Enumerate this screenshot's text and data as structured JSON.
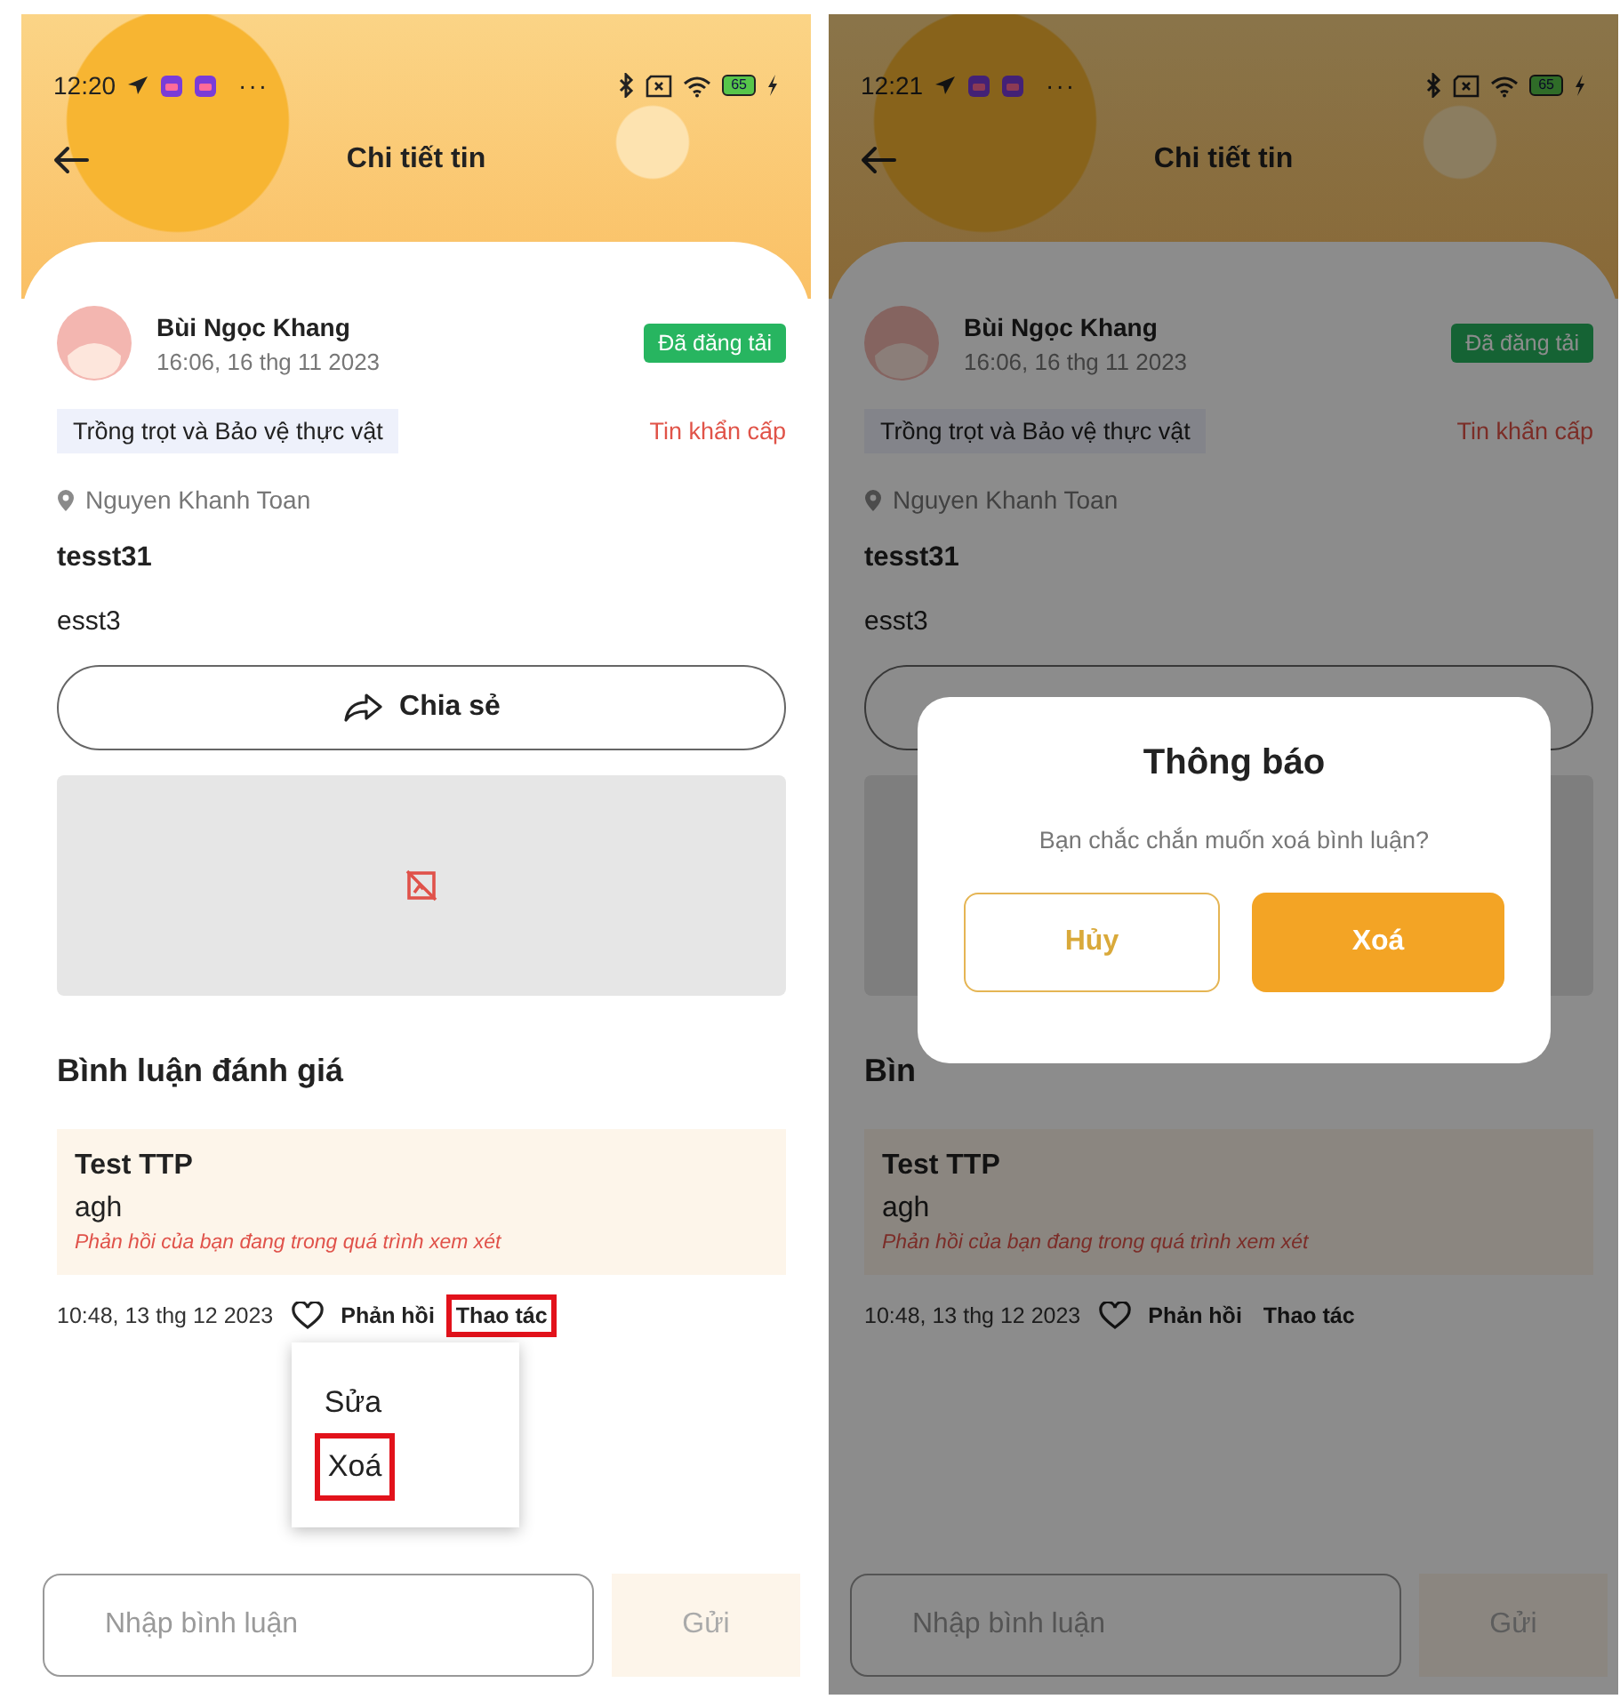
{
  "screens": [
    {
      "status_bar": {
        "time": "12:20",
        "dots": "···",
        "battery": "65"
      },
      "header": {
        "title": "Chi tiết tin"
      },
      "post": {
        "author": "Bùi Ngọc Khang",
        "time": "16:06, 16 thg 11 2023",
        "status_badge": "Đã đăng tải",
        "category": "Trồng trọt và Bảo vệ thực vật",
        "urgency": "Tin khẩn cấp",
        "location": "Nguyen Khanh Toan",
        "title": "tesst31",
        "body": "esst3",
        "share_button": {
          "label": "Chia sẻ"
        },
        "media": {
          "kind": "broken"
        }
      },
      "comments_heading": "Bình luận đánh giá",
      "comments": [
        {
          "author": "Test TTP",
          "text": "agh",
          "note": "Phản hồi của bạn đang trong quá trình xem xét",
          "time": "10:48, 13 thg 12 2023",
          "reply": "Phản hồi",
          "actions": "Thao tác",
          "actions_highlighted": true
        }
      ],
      "action_menu": {
        "items": [
          {
            "label": "Sửa",
            "highlighted": false
          },
          {
            "label": "Xoá",
            "highlighted": true
          }
        ]
      },
      "comment_input": {
        "placeholder": "Nhập bình luận"
      },
      "send_button": "Gửi"
    },
    {
      "status_bar": {
        "time": "12:21",
        "dots": "···",
        "battery": "65"
      },
      "header": {
        "title": "Chi tiết tin"
      },
      "post": {
        "author": "Bùi Ngọc Khang",
        "time": "16:06, 16 thg 11 2023",
        "status_badge": "Đã đăng tải",
        "category": "Trồng trọt và Bảo vệ thực vật",
        "urgency": "Tin khẩn cấp",
        "location": "Nguyen Khanh Toan",
        "title": "tesst31",
        "body": "esst3",
        "media": {
          "kind": "empty"
        }
      },
      "comments_heading": "Bìn",
      "comments": [
        {
          "author": "Test TTP",
          "text": "agh",
          "note": "Phản hồi của bạn đang trong quá trình xem xét",
          "time": "10:48, 13 thg 12 2023",
          "reply": "Phản hồi",
          "actions": "Thao tác",
          "actions_highlighted": false
        }
      ],
      "comment_input": {
        "placeholder": "Nhập bình luận"
      },
      "send_button": "Gửi",
      "dialog": {
        "title": "Thông báo",
        "message": "Bạn chắc chắn muốn xoá bình luận?",
        "buttons": [
          {
            "label": "Hủy",
            "kind": "outline"
          },
          {
            "label": "Xoá",
            "kind": "filled"
          }
        ]
      }
    }
  ]
}
